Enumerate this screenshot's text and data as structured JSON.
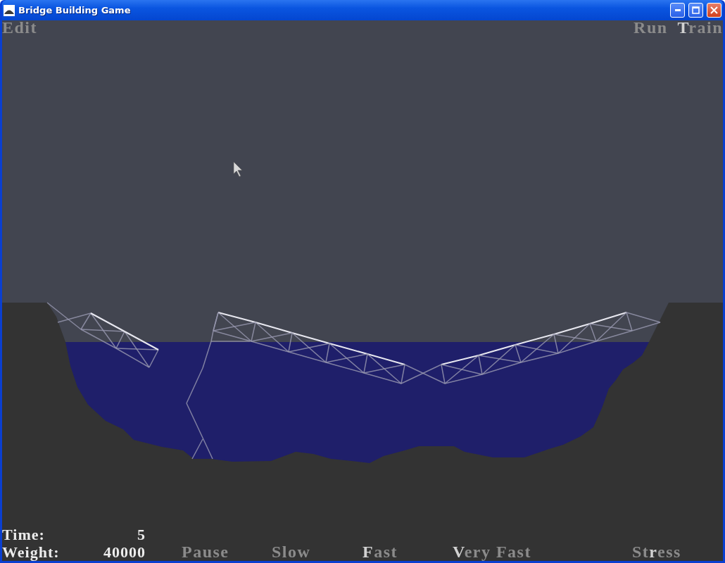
{
  "window": {
    "title": "Bridge Building Game"
  },
  "menu_left": [
    {
      "parts": [
        {
          "text": "Edit",
          "bright": false
        }
      ]
    }
  ],
  "menu_right": [
    {
      "parts": [
        {
          "text": "Run",
          "bright": false
        }
      ]
    },
    {
      "parts": [
        {
          "text": "T",
          "bright": true
        },
        {
          "text": "rain",
          "bright": false
        }
      ]
    }
  ],
  "stats": [
    {
      "label": "Time:",
      "value": "5"
    },
    {
      "label": "Weight:",
      "value": "40000"
    }
  ],
  "speed_controls": [
    {
      "parts": [
        {
          "text": "Pause",
          "bright": false
        }
      ]
    },
    {
      "parts": [
        {
          "text": "Slow",
          "bright": false
        }
      ]
    },
    {
      "parts": [
        {
          "text": "F",
          "bright": true
        },
        {
          "text": "ast",
          "bright": false
        }
      ]
    },
    {
      "parts": [
        {
          "text": "V",
          "bright": true
        },
        {
          "text": "ery Fast",
          "bright": false
        }
      ]
    },
    {
      "parts": [
        {
          "text": "St",
          "bright": false
        },
        {
          "text": "r",
          "bright": true
        },
        {
          "text": "ess",
          "bright": false
        }
      ]
    }
  ]
}
